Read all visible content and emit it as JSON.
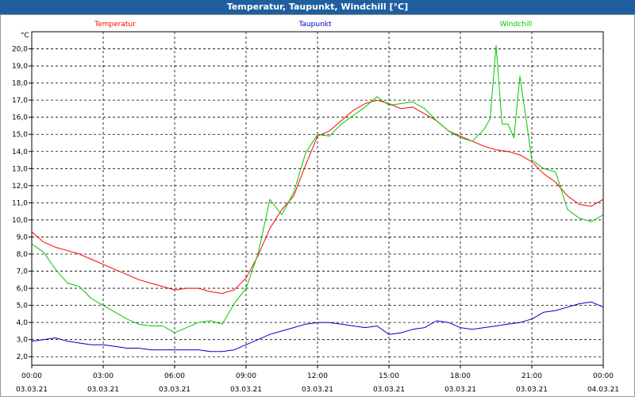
{
  "window": {
    "title": "Temperatur, Taupunkt, Windchill [°C]"
  },
  "chart_data": {
    "type": "line",
    "title": "Temperatur, Taupunkt, Windchill [°C]",
    "unit_label": "°C",
    "ylim": [
      1.5,
      21.0
    ],
    "yticks": [
      2.0,
      3.0,
      4.0,
      5.0,
      6.0,
      7.0,
      8.0,
      9.0,
      10.0,
      11.0,
      12.0,
      13.0,
      14.0,
      15.0,
      16.0,
      17.0,
      18.0,
      19.0,
      20.0
    ],
    "ytick_labels": [
      "2,0",
      "3,0",
      "4,0",
      "5,0",
      "6,0",
      "7,0",
      "8,0",
      "9,0",
      "10,0",
      "11,0",
      "12,0",
      "13,0",
      "14,0",
      "15,0",
      "16,0",
      "17,0",
      "18,0",
      "19,0",
      "20,0"
    ],
    "xlim": [
      0,
      24
    ],
    "xticks": [
      0,
      3,
      6,
      9,
      12,
      15,
      18,
      21,
      24
    ],
    "xtick_time": [
      "00:00",
      "03:00",
      "06:00",
      "09:00",
      "12:00",
      "15:00",
      "18:00",
      "21:00",
      "00:00"
    ],
    "xtick_date": [
      "03.03.21",
      "03.03.21",
      "03.03.21",
      "03.03.21",
      "03.03.21",
      "03.03.21",
      "03.03.21",
      "03.03.21",
      "04.03.21"
    ],
    "grid": true,
    "legend_position": "top",
    "series": [
      {
        "name": "Temperatur",
        "color": "#ff0000",
        "x": [
          0,
          0.5,
          1,
          1.5,
          2,
          2.5,
          3,
          3.5,
          4,
          4.5,
          5,
          5.5,
          6,
          6.5,
          7,
          7.5,
          8,
          8.5,
          9,
          9.5,
          10,
          10.5,
          11,
          11.5,
          12,
          12.5,
          13,
          13.5,
          14,
          14.5,
          15,
          15.5,
          16,
          16.5,
          17,
          17.5,
          18,
          18.5,
          19,
          19.5,
          20,
          20.5,
          21,
          21.5,
          22,
          22.5,
          23,
          23.5,
          24
        ],
        "y": [
          9.3,
          8.7,
          8.4,
          8.2,
          8.0,
          7.7,
          7.4,
          7.1,
          6.8,
          6.5,
          6.3,
          6.1,
          5.9,
          6.0,
          6.0,
          5.8,
          5.7,
          5.9,
          6.6,
          7.9,
          9.5,
          10.6,
          11.4,
          13.2,
          14.9,
          15.2,
          15.8,
          16.4,
          16.8,
          17.0,
          16.8,
          16.5,
          16.6,
          16.2,
          15.8,
          15.2,
          14.9,
          14.6,
          14.3,
          14.1,
          14.0,
          13.8,
          13.4,
          12.7,
          12.2,
          11.4,
          10.9,
          10.8,
          11.2
        ]
      },
      {
        "name": "Taupunkt",
        "color": "#0000c8",
        "x": [
          0,
          0.5,
          1,
          1.5,
          2,
          2.5,
          3,
          3.5,
          4,
          4.5,
          5,
          5.5,
          6,
          6.5,
          7,
          7.5,
          8,
          8.5,
          9,
          9.5,
          10,
          10.5,
          11,
          11.5,
          12,
          12.5,
          13,
          13.5,
          14,
          14.5,
          15,
          15.5,
          16,
          16.5,
          17,
          17.5,
          18,
          18.5,
          19,
          19.5,
          20,
          20.5,
          21,
          21.5,
          22,
          22.5,
          23,
          23.5,
          24
        ],
        "y": [
          2.9,
          3.0,
          3.1,
          2.9,
          2.8,
          2.7,
          2.7,
          2.6,
          2.5,
          2.5,
          2.4,
          2.4,
          2.4,
          2.4,
          2.4,
          2.3,
          2.3,
          2.4,
          2.7,
          3.0,
          3.3,
          3.5,
          3.7,
          3.9,
          4.0,
          4.0,
          3.9,
          3.8,
          3.7,
          3.8,
          3.3,
          3.4,
          3.6,
          3.7,
          4.1,
          4.0,
          3.7,
          3.6,
          3.7,
          3.8,
          3.9,
          4.0,
          4.2,
          4.6,
          4.7,
          4.9,
          5.1,
          5.2,
          4.9
        ]
      },
      {
        "name": "Windchill",
        "color": "#00c800",
        "x": [
          0,
          0.5,
          1,
          1.5,
          2,
          2.5,
          3,
          3.5,
          4,
          4.5,
          5,
          5.5,
          6,
          6.5,
          7,
          7.5,
          8,
          8.5,
          9,
          9.5,
          10,
          10.5,
          11,
          11.5,
          12,
          12.5,
          13,
          13.5,
          14,
          14.5,
          15,
          15.5,
          16,
          16.5,
          17,
          17.5,
          18,
          18.5,
          19,
          19.25,
          19.5,
          19.75,
          20,
          20.25,
          20.5,
          20.75,
          21,
          21.5,
          22,
          22.5,
          23,
          23.5,
          24
        ],
        "y": [
          8.6,
          8.1,
          7.1,
          6.3,
          6.1,
          5.4,
          5.0,
          4.6,
          4.2,
          3.9,
          3.8,
          3.8,
          3.4,
          3.7,
          4.0,
          4.1,
          3.9,
          5.1,
          6.0,
          8.0,
          11.2,
          10.3,
          11.6,
          13.9,
          15.0,
          14.9,
          15.6,
          16.1,
          16.6,
          17.2,
          16.7,
          16.8,
          16.9,
          16.5,
          15.8,
          15.2,
          14.8,
          14.6,
          15.3,
          15.9,
          20.2,
          15.6,
          15.6,
          14.8,
          18.4,
          16.0,
          13.5,
          13.0,
          12.8,
          10.6,
          10.1,
          9.9,
          10.3
        ]
      }
    ]
  }
}
